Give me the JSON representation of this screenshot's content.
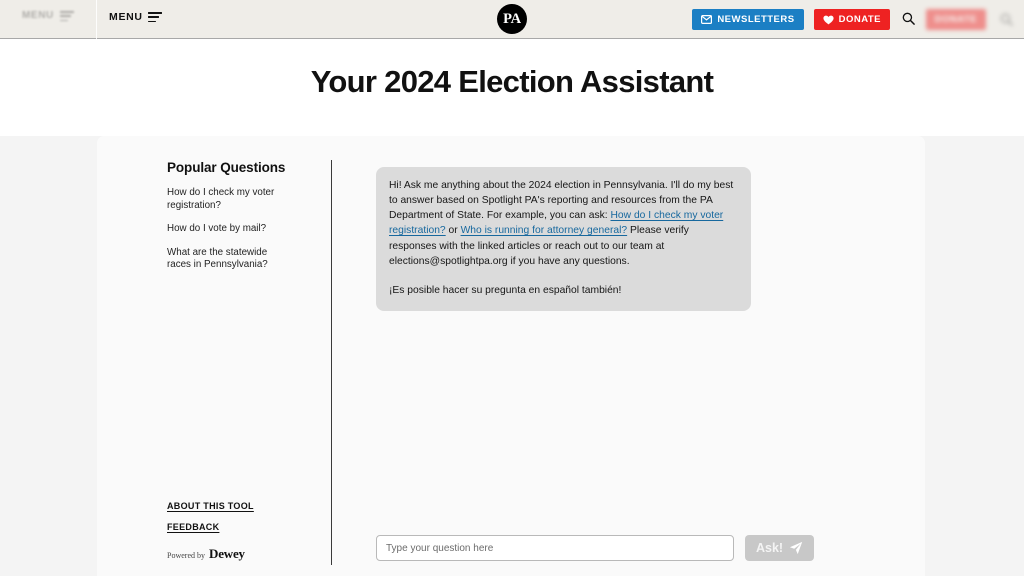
{
  "header": {
    "menu_label": "MENU",
    "ghost_menu_label": "MENU",
    "logo_text": "PA",
    "newsletters_label": "NEWSLETTERS",
    "donate_label": "DONATE",
    "ghost_donate_label": "DONATE",
    "icons": {
      "hamburger": "hamburger-icon",
      "envelope": "envelope-icon",
      "heart": "heart-icon",
      "search": "search-icon"
    },
    "colors": {
      "background": "#efede8",
      "newsletters_blue": "#1b7fc4",
      "donate_red": "#ee2222",
      "logo_black": "#000000"
    }
  },
  "page": {
    "title": "Your 2024 Election Assistant"
  },
  "sidebar": {
    "heading": "Popular Questions",
    "questions": [
      "How do I check my voter registration?",
      "How do I vote by mail?",
      "What are the statewide races in Pennsylvania?"
    ],
    "links": [
      "ABOUT THIS TOOL",
      "FEEDBACK"
    ],
    "powered_by": {
      "label": "Powered by",
      "brand": "Dewey"
    }
  },
  "chat": {
    "message": {
      "part1": "Hi! Ask me anything about the 2024 election in Pennsylvania. I'll do my best to answer based on Spotlight PA's reporting and resources from the PA Department of State. For example, you can ask: ",
      "link1": "How do I check my voter registration?",
      "between": " or ",
      "link2": "Who is running for attorney general?",
      "part2": " Please verify responses with the linked articles or reach out to our team at elections@spotlightpa.org if you have any questions.",
      "spanish": "¡Es posible hacer su pregunta en español también!"
    }
  },
  "composer": {
    "placeholder": "Type your question here",
    "value": "",
    "ask_label": "Ask!",
    "send_icon": "paper-plane-icon"
  }
}
